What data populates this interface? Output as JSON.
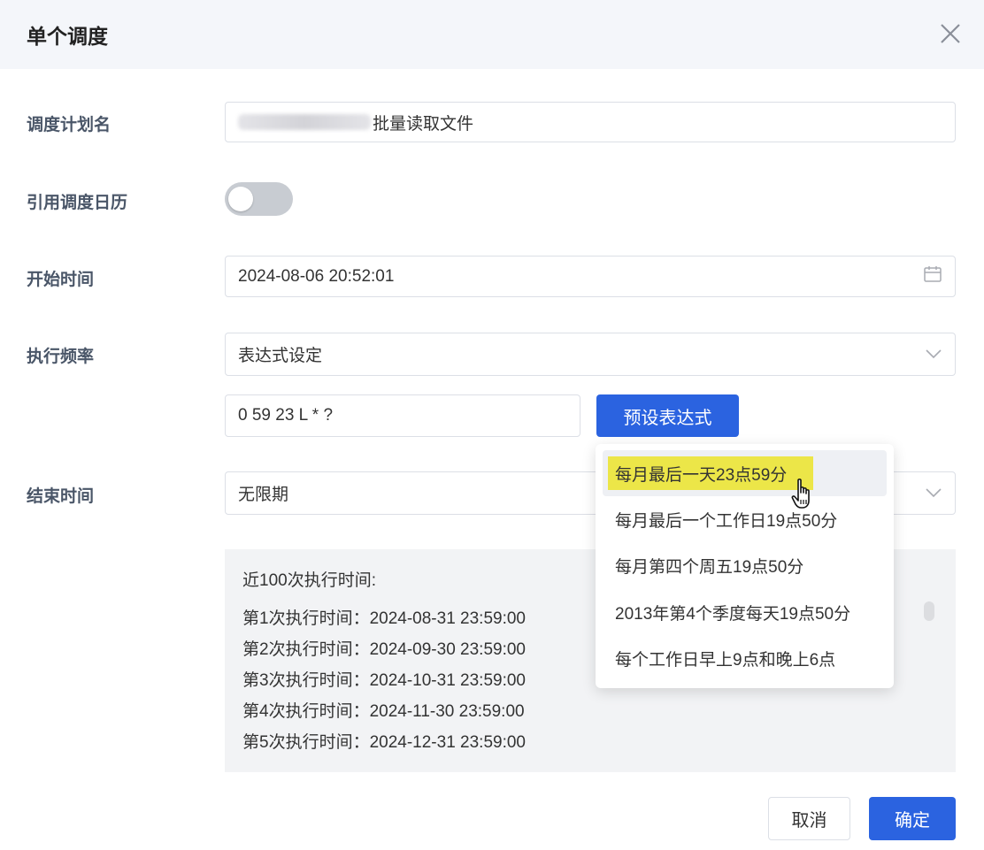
{
  "dialog": {
    "title": "单个调度"
  },
  "form": {
    "plan_name": {
      "label": "调度计划名",
      "value": "批量读取文件"
    },
    "use_calendar": {
      "label": "引用调度日历",
      "enabled": false
    },
    "start_time": {
      "label": "开始时间",
      "value": "2024-08-06 20:52:01"
    },
    "frequency": {
      "label": "执行频率",
      "value": "表达式设定"
    },
    "cron": {
      "value": "0 59 23 L * ?"
    },
    "preset_button": "预设表达式",
    "end_time": {
      "label": "结束时间",
      "value": "无限期"
    }
  },
  "preview": {
    "heading": "近100次执行时间:",
    "rows": [
      "第1次执行时间：2024-08-31 23:59:00",
      "第2次执行时间：2024-09-30 23:59:00",
      "第3次执行时间：2024-10-31 23:59:00",
      "第4次执行时间：2024-11-30 23:59:00",
      "第5次执行时间：2024-12-31 23:59:00"
    ]
  },
  "presets": [
    "每月最后一天23点59分",
    "每月最后一个工作日19点50分",
    "每月第四个周五19点50分",
    "2013年第4个季度每天19点50分",
    "每个工作日早上9点和晚上6点"
  ],
  "footer": {
    "cancel": "取消",
    "confirm": "确定"
  },
  "colors": {
    "primary": "#2b63e0",
    "highlight": "#ece648"
  }
}
